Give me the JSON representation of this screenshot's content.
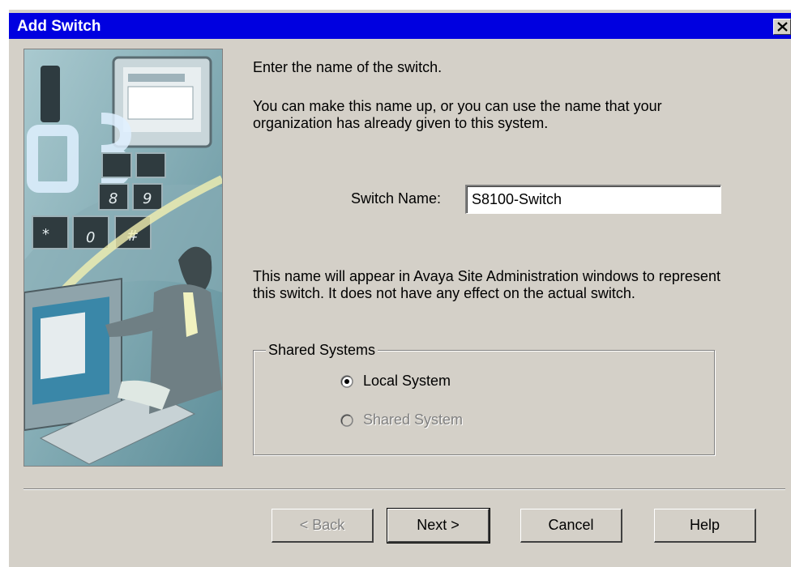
{
  "window": {
    "title": "Add Switch"
  },
  "intro": {
    "line1": "Enter the name of the switch.",
    "line2": "You can make this name up, or you can use the name that your organization has already given to this system."
  },
  "switch_name": {
    "label": "Switch Name:",
    "value": "S8100-Switch"
  },
  "note": "This name will appear in Avaya Site Administration windows to represent this switch.  It does not have any effect on the actual switch.",
  "shared_systems": {
    "legend": "Shared Systems",
    "options": [
      {
        "label": "Local System",
        "selected": true,
        "enabled": true
      },
      {
        "label": "Shared System",
        "selected": false,
        "enabled": false
      }
    ]
  },
  "buttons": {
    "back": "< Back",
    "next": "Next >",
    "cancel": "Cancel",
    "help": "Help"
  },
  "colors": {
    "titlebar": "#0000e0",
    "dialog": "#d4d0c8"
  },
  "icons": [
    "close-icon",
    "radio-selected-icon",
    "radio-unselected-icon"
  ]
}
